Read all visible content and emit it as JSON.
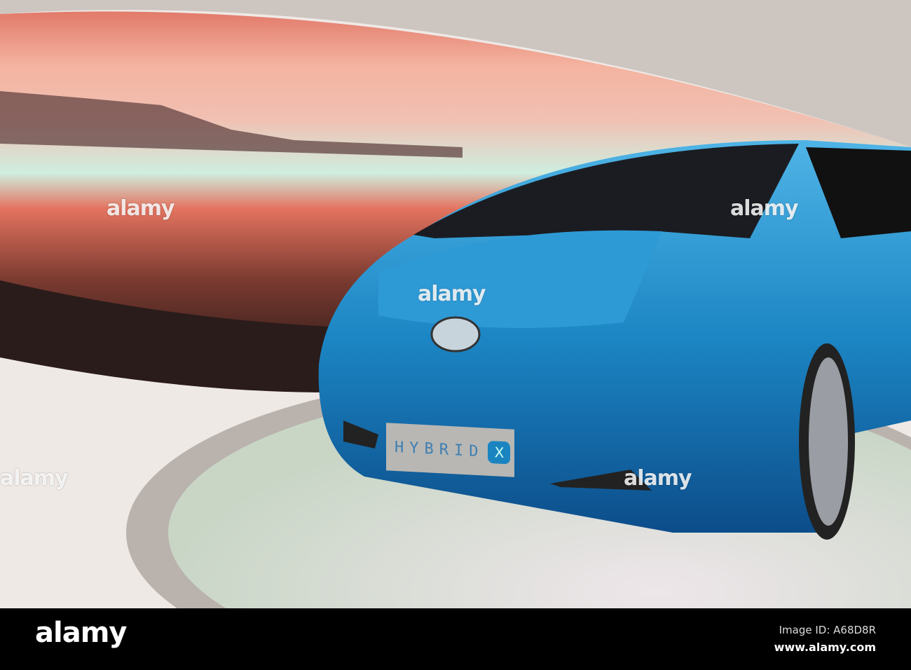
{
  "watermark": {
    "text": "alamy"
  },
  "car": {
    "plate_text": "HYBRID",
    "plate_badge": "X"
  },
  "footer": {
    "logo": "alamy",
    "image_id": "Image ID: A68D8R",
    "url": "www.alamy.com"
  },
  "colors": {
    "car_blue": "#1b7fc0",
    "screen_red": "#d8584c",
    "floor": "#d9dcd4"
  }
}
